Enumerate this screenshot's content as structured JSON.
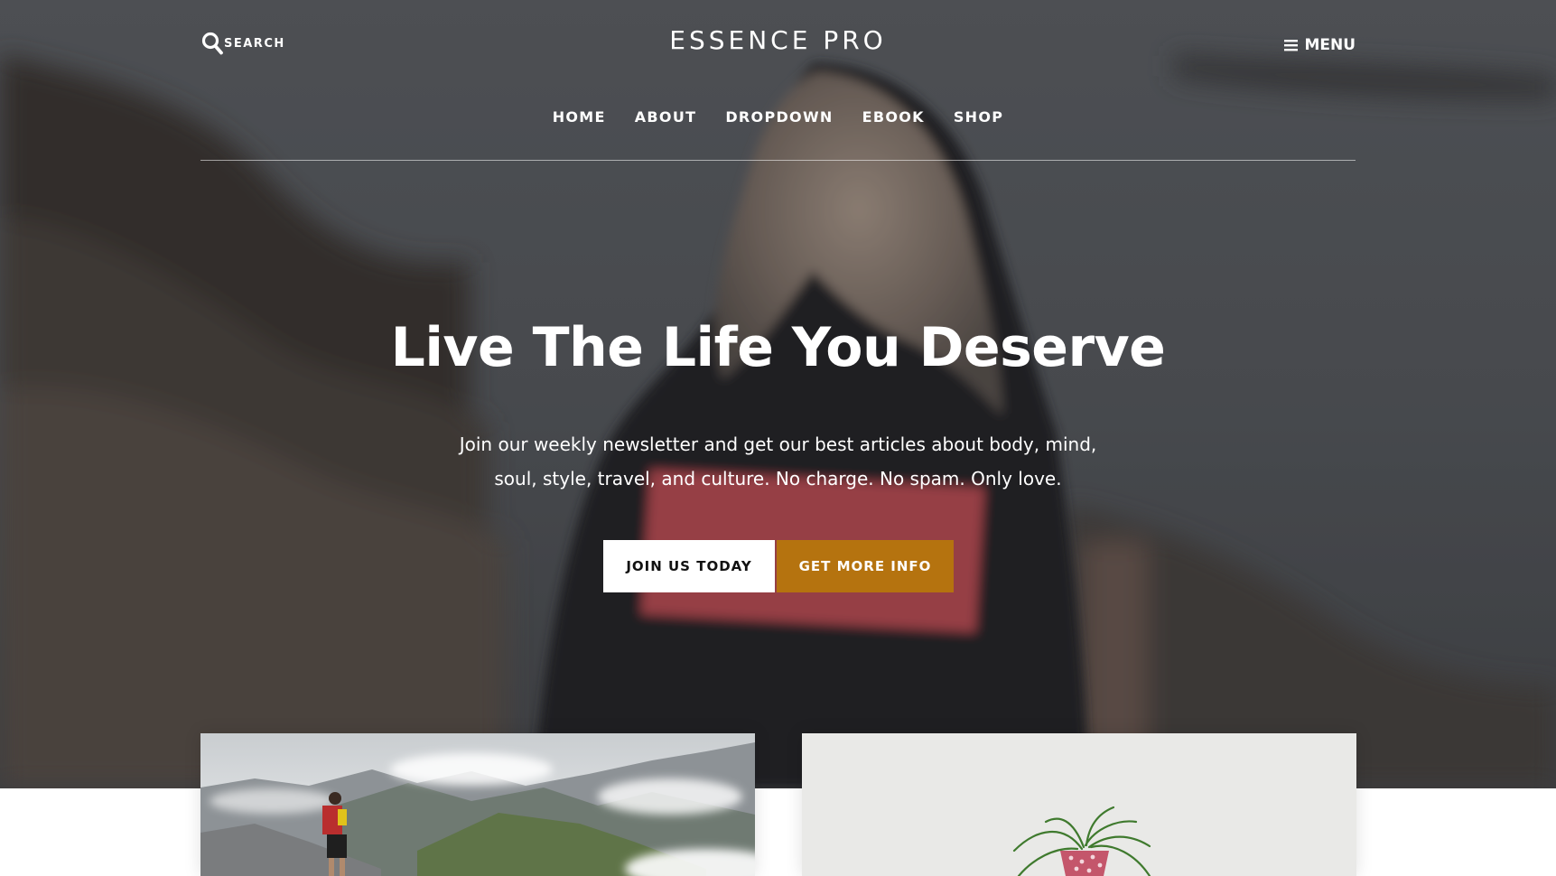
{
  "header": {
    "search_label": "SEARCH",
    "site_title": "ESSENCE PRO",
    "menu_label": "MENU"
  },
  "nav": {
    "items": [
      {
        "label": "HOME"
      },
      {
        "label": "ABOUT"
      },
      {
        "label": "DROPDOWN"
      },
      {
        "label": "EBOOK"
      },
      {
        "label": "SHOP"
      }
    ]
  },
  "hero": {
    "headline": "Live The Life You Deserve",
    "subhead": "Join our weekly newsletter and get our best articles about body, mind, soul, style, travel, and culture. No charge. No spam. Only love.",
    "primary_button": "JOIN US TODAY",
    "secondary_button": "GET MORE INFO"
  },
  "colors": {
    "accent": "#b5730f",
    "text_on_hero": "#ffffff",
    "button_primary_bg": "#ffffff"
  },
  "icons": {
    "search": "search-icon",
    "menu": "hamburger-icon"
  }
}
